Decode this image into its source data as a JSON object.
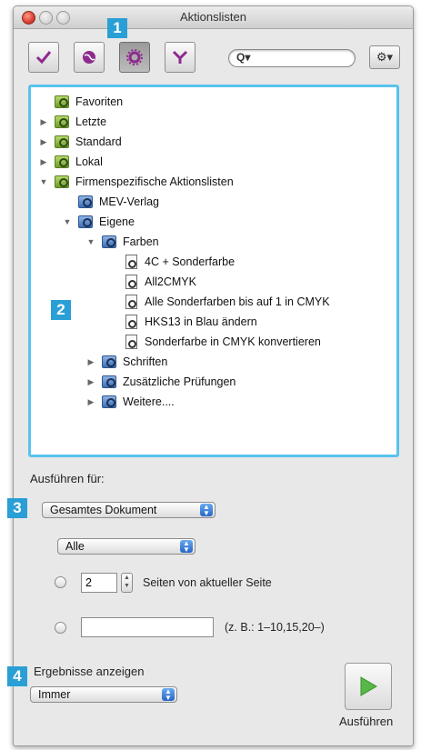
{
  "window": {
    "title": "Aktionslisten"
  },
  "markers": [
    "1",
    "2",
    "3",
    "4"
  ],
  "toolbar": {
    "buttons": [
      {
        "icon": "checkmark-icon",
        "color": "#8e2a8e"
      },
      {
        "icon": "globe-icon",
        "color": "#8e2a8e"
      },
      {
        "icon": "gear-icon",
        "color": "#8e2a8e"
      },
      {
        "icon": "filter-icon",
        "color": "#8e2a8e"
      }
    ],
    "search_placeholder": "",
    "search_icon_label": "Q▾",
    "gear_menu_label": "⚙▾"
  },
  "tree": {
    "items": [
      {
        "label": "Favoriten",
        "expander": "",
        "icon": "green"
      },
      {
        "label": "Letzte",
        "expander": "▶",
        "icon": "green"
      },
      {
        "label": "Standard",
        "expander": "▶",
        "icon": "green"
      },
      {
        "label": "Lokal",
        "expander": "▶",
        "icon": "green"
      },
      {
        "label": "Firmenspezifische Aktionslisten",
        "expander": "▼",
        "icon": "green"
      },
      {
        "label": "MEV-Verlag",
        "expander": "",
        "icon": "blue"
      },
      {
        "label": "Eigene",
        "expander": "▼",
        "icon": "blue"
      },
      {
        "label": "Farben",
        "expander": "▼",
        "icon": "blue"
      },
      {
        "label": "4C + Sonderfarbe",
        "expander": "",
        "icon": "doc"
      },
      {
        "label": "All2CMYK",
        "expander": "",
        "icon": "doc"
      },
      {
        "label": "Alle Sonderfarben bis auf 1 in CMYK",
        "expander": "",
        "icon": "doc"
      },
      {
        "label": "HKS13 in Blau ändern",
        "expander": "",
        "icon": "doc"
      },
      {
        "label": "Sonderfarbe in CMYK konvertieren",
        "expander": "",
        "icon": "doc"
      },
      {
        "label": "Schriften",
        "expander": "▶",
        "icon": "blue"
      },
      {
        "label": "Zusätzliche Prüfungen",
        "expander": "▶",
        "icon": "blue"
      },
      {
        "label": "Weitere....",
        "expander": "▶",
        "icon": "blue"
      }
    ]
  },
  "run_for": {
    "label": "Ausführen für:",
    "scope_value": "Gesamtes Dokument",
    "pages_value": "Alle",
    "pages_count_value": "2",
    "pages_count_suffix": "Seiten von aktueller Seite",
    "range_value": "",
    "range_hint": "(z. B.: 1–10,15,20–)"
  },
  "results": {
    "label": "Ergebnisse anzeigen",
    "value": "Immer"
  },
  "run_button": {
    "label": "Ausführen",
    "color": "#56b846"
  },
  "colors": {
    "accent": "#2a9fd6",
    "tree_border": "#58c3ee"
  }
}
